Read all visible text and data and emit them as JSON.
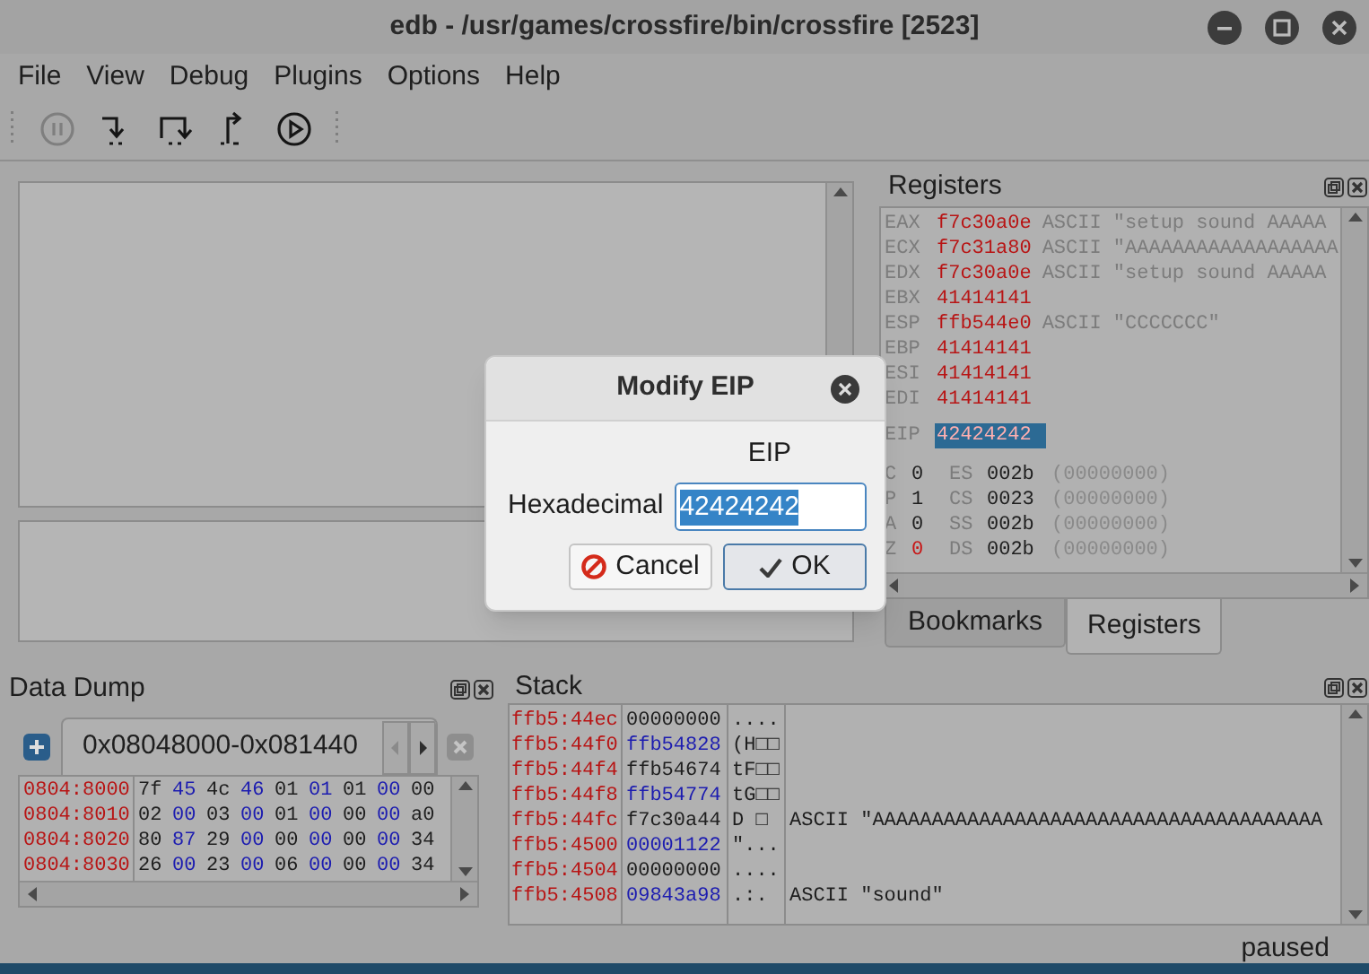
{
  "window": {
    "title": "edb - /usr/games/crossfire/bin/crossfire [2523]"
  },
  "menu": [
    "File",
    "View",
    "Debug",
    "Plugins",
    "Options",
    "Help"
  ],
  "toolbar": [
    {
      "kind": "pause",
      "disabled": true
    },
    {
      "kind": "step_into",
      "disabled": false
    },
    {
      "kind": "step_over",
      "disabled": false
    },
    {
      "kind": "step_out",
      "disabled": false
    },
    {
      "kind": "run",
      "disabled": false
    }
  ],
  "registers": {
    "title": "Registers",
    "rows": [
      {
        "name": "EAX",
        "value": "f7c30a0e",
        "comment": "ASCII \"setup sound AAAAA",
        "changed": true,
        "selected": false
      },
      {
        "name": "ECX",
        "value": "f7c31a80",
        "comment": "ASCII \"AAAAAAAAAAAAAAAAAA",
        "changed": true,
        "selected": false
      },
      {
        "name": "EDX",
        "value": "f7c30a0e",
        "comment": "ASCII \"setup sound AAAAA",
        "changed": true,
        "selected": false
      },
      {
        "name": "EBX",
        "value": "41414141",
        "changed": true,
        "selected": false
      },
      {
        "name": "ESP",
        "value": "ffb544e0",
        "comment": "ASCII \"CCCCCCC\"",
        "changed": true,
        "selected": false
      },
      {
        "name": "EBP",
        "value": "41414141",
        "changed": true,
        "selected": false
      },
      {
        "name": "ESI",
        "value": "41414141",
        "changed": true,
        "selected": false
      },
      {
        "name": "EDI",
        "value": "41414141",
        "changed": true,
        "selected": false
      },
      {
        "name": "EIP",
        "value": "42424242",
        "changed": true,
        "selected": true
      }
    ],
    "flags": [
      {
        "flag": "C",
        "value": "0",
        "changed": false,
        "segment": "ES",
        "selector": "002b",
        "base": "(00000000)"
      },
      {
        "flag": "P",
        "value": "1",
        "changed": false,
        "segment": "CS",
        "selector": "0023",
        "base": "(00000000)"
      },
      {
        "flag": "A",
        "value": "0",
        "changed": false,
        "segment": "SS",
        "selector": "002b",
        "base": "(00000000)"
      },
      {
        "flag": "Z",
        "value": "0",
        "changed": true,
        "segment": "DS",
        "selector": "002b",
        "base": "(00000000)"
      }
    ],
    "tabs": [
      {
        "label": "Bookmarks",
        "selected": false
      },
      {
        "label": "Registers",
        "selected": true
      }
    ]
  },
  "data_dump": {
    "title": "Data Dump",
    "tab": "0x08048000-0x081440",
    "rows": [
      {
        "address": "0804:8000",
        "bytes": [
          "7f",
          "45",
          "4c",
          "46",
          "01",
          "01",
          "01",
          "00",
          "00"
        ]
      },
      {
        "address": "0804:8010",
        "bytes": [
          "02",
          "00",
          "03",
          "00",
          "01",
          "00",
          "00",
          "00",
          "a0"
        ]
      },
      {
        "address": "0804:8020",
        "bytes": [
          "80",
          "87",
          "29",
          "00",
          "00",
          "00",
          "00",
          "00",
          "34"
        ]
      },
      {
        "address": "0804:8030",
        "bytes": [
          "26",
          "00",
          "23",
          "00",
          "06",
          "00",
          "00",
          "00",
          "34"
        ]
      }
    ]
  },
  "stack": {
    "title": "Stack",
    "rows": [
      {
        "address": "ffb5:44ec",
        "value": "00000000",
        "ascii": "...."
      },
      {
        "address": "ffb5:44f0",
        "value": "ffb54828",
        "ascii": "(H□□"
      },
      {
        "address": "ffb5:44f4",
        "value": "ffb54674",
        "ascii": "tF□□"
      },
      {
        "address": "ffb5:44f8",
        "value": "ffb54774",
        "ascii": "tG□□"
      },
      {
        "address": "ffb5:44fc",
        "value": "f7c30a44",
        "ascii": "D □",
        "comment": "ASCII \"AAAAAAAAAAAAAAAAAAAAAAAAAAAAAAAAAAAAAA"
      },
      {
        "address": "ffb5:4500",
        "value": "00001122",
        "ascii": "\"..."
      },
      {
        "address": "ffb5:4504",
        "value": "00000000",
        "ascii": "...."
      },
      {
        "address": "ffb5:4508",
        "value": "09843a98",
        "ascii": ".:.",
        "comment": "ASCII \"sound\""
      }
    ]
  },
  "dialog": {
    "title": "Modify EIP",
    "heading": "EIP",
    "field_label": "Hexadecimal",
    "value": "42424242",
    "buttons": [
      {
        "label": "Cancel",
        "kind": "cancel"
      },
      {
        "label": "OK",
        "kind": "ok"
      }
    ]
  },
  "status_bar": "paused"
}
